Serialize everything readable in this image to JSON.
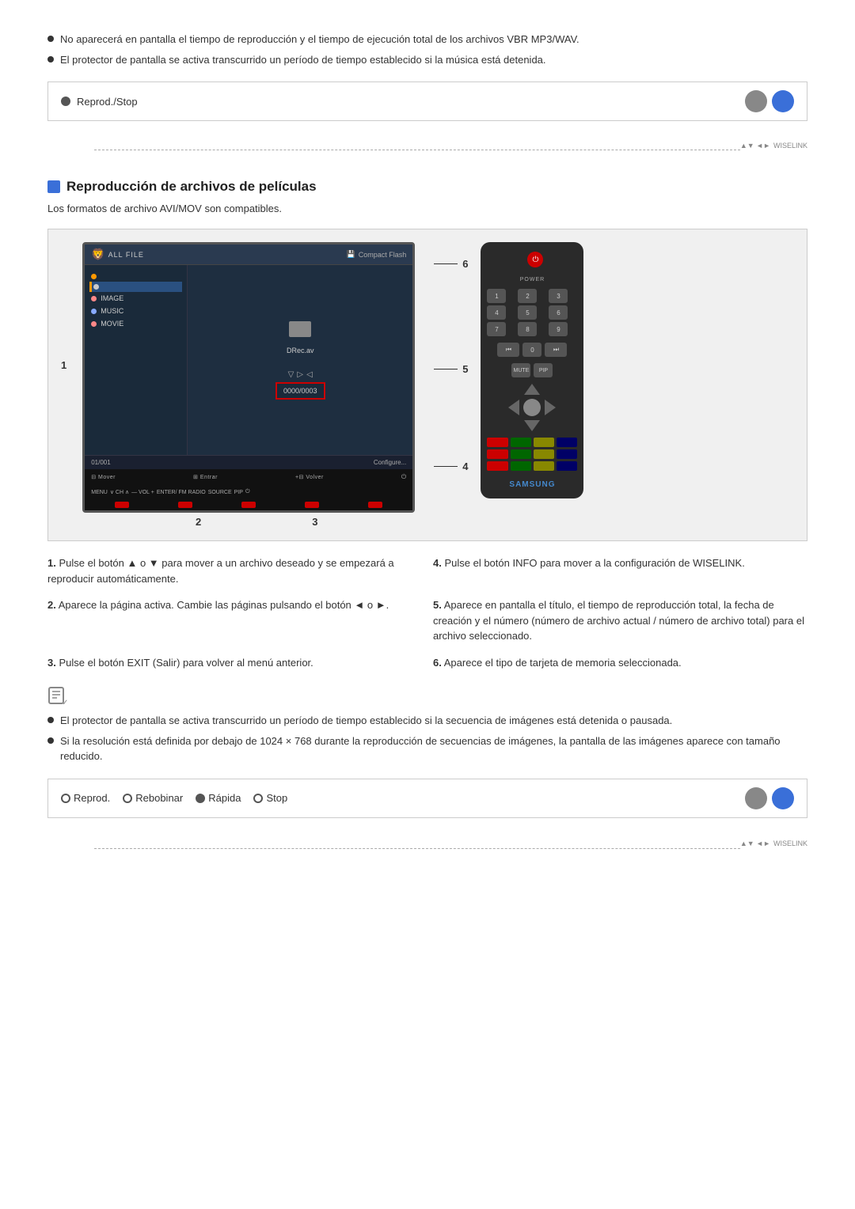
{
  "top_bullets": [
    "No aparecerá en pantalla el tiempo de reproducción y el tiempo de ejecución total de los archivos VBR MP3/WAV.",
    "El protector de pantalla se activa transcurrido un período de tiempo establecido si la música está detenida."
  ],
  "top_control_box": {
    "label": "Reprod./Stop",
    "radio_type": "filled"
  },
  "section_title": "Reproducción de archivos de películas",
  "section_subtitle": "Los formatos de archivo AVI/MOV son compatibles.",
  "diagram": {
    "tv": {
      "top_bar": {
        "logo": "ALL FILE",
        "media": "Compact Flash"
      },
      "sidebar_items": [
        {
          "label": "",
          "color": "#ff9900",
          "active": false
        },
        {
          "label": "",
          "color": "#ccc",
          "active": true
        },
        {
          "label": "IMAGE",
          "color": "#f88",
          "active": false
        },
        {
          "label": "MUSIC",
          "color": "#8af",
          "active": false
        },
        {
          "label": "MOVIE",
          "color": "#f88",
          "active": false
        }
      ],
      "file_display": "DRec.av",
      "progress_text": "0000/0003",
      "bottom_status": "01/001",
      "bottom_config": "Configure",
      "nav_items": [
        "Mover",
        "Entrar",
        "Volver"
      ]
    },
    "remote": {
      "brand": "SAMSUNG"
    },
    "annotations": {
      "left": [
        "1"
      ],
      "bottom": [
        "2",
        "3"
      ],
      "right": [
        "4",
        "5",
        "6"
      ]
    }
  },
  "instructions": [
    {
      "number": "1",
      "text": "Pulse el botón ▲ o ▼ para mover a un archivo deseado y se empezará a reproducir automáticamente."
    },
    {
      "number": "4",
      "text": "Pulse el botón INFO para mover a la configuración de WISELINK."
    },
    {
      "number": "2",
      "text": "Aparece la página activa. Cambie las páginas pulsando el botón ◄ o ►."
    },
    {
      "number": "5",
      "text": "Aparece en pantalla el título, el tiempo de reproducción total, la fecha de creación y el número (número de archivo actual / número de archivo total) para el archivo seleccionado."
    },
    {
      "number": "3",
      "text": "Pulse el botón EXIT (Salir) para volver al menú anterior."
    },
    {
      "number": "6",
      "text": "Aparece el tipo de tarjeta de memoria seleccionada."
    }
  ],
  "note_bullets": [
    "El protector de pantalla se activa transcurrido un período de tiempo establecido si la secuencia de imágenes está detenida o pausada.",
    "Si la resolución está definida por debajo de 1024 × 768 durante la reproducción de secuencias de imágenes, la pantalla de las imágenes aparece con tamaño reducido."
  ],
  "bottom_control_box": {
    "options": [
      {
        "label": "Reprod.",
        "selected": false
      },
      {
        "label": "Rebobinar",
        "selected": false
      },
      {
        "label": "Rápida",
        "selected": true
      },
      {
        "label": "Stop",
        "selected": false
      }
    ]
  },
  "nav_footer": {
    "text": "WISELINK"
  }
}
